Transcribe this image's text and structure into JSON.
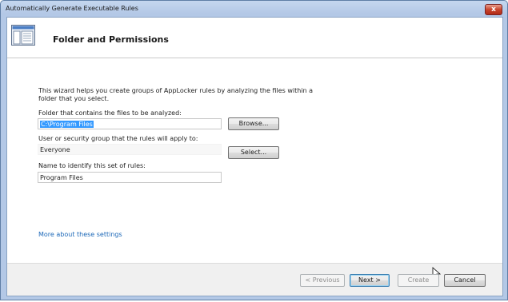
{
  "window": {
    "title": "Automatically Generate Executable Rules",
    "close_label": "x"
  },
  "header": {
    "title": "Folder and Permissions",
    "icon": "wizard-page-icon"
  },
  "form": {
    "description": "This wizard helps you create groups of AppLocker rules by analyzing the files within a\nfolder that you select.",
    "folder_label": "Folder that contains the files to be analyzed:",
    "folder_value": "C:\\Program Files",
    "browse_label": "Browse...",
    "group_label": "User or security group that the rules will apply to:",
    "group_value": "Everyone",
    "select_label": "Select...",
    "name_label": "Name to identify this set of rules:",
    "name_value": "Program Files",
    "more_link": "More about these settings"
  },
  "footer": {
    "previous_label": "< Previous",
    "next_label": "Next >",
    "create_label": "Create",
    "cancel_label": "Cancel"
  },
  "colors": {
    "link": "#1c68b8",
    "selection": "#3399ff",
    "frame": "#b3c8e6"
  }
}
